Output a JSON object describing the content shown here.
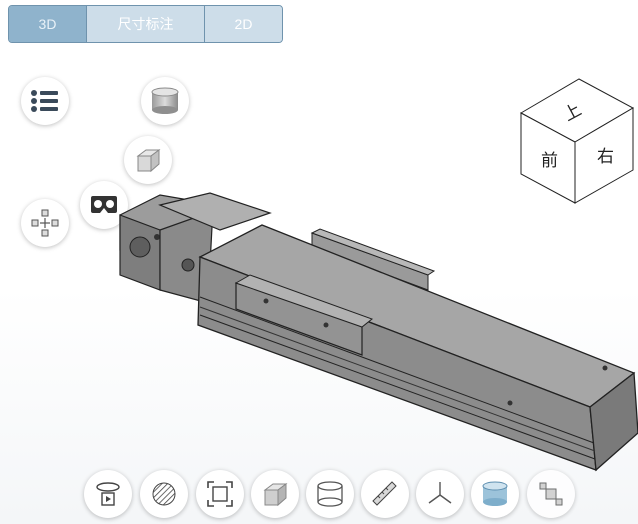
{
  "tabs": [
    {
      "label": "3D",
      "active": true
    },
    {
      "label": "尺寸标注",
      "active": false
    },
    {
      "label": "2D",
      "active": false
    }
  ],
  "viewcube": {
    "top": "上",
    "front": "前",
    "right": "右"
  },
  "side_tools": [
    {
      "icon": "list-icon"
    },
    {
      "icon": "cylinder-shaded-icon"
    },
    {
      "icon": "cube-wireframe-icon"
    },
    {
      "icon": "vr-goggles-icon"
    },
    {
      "icon": "explode-view-icon"
    }
  ],
  "bottom_tools": [
    {
      "icon": "rotate-play-icon"
    },
    {
      "icon": "section-hatch-icon"
    },
    {
      "icon": "fit-view-icon"
    },
    {
      "icon": "cube-shaded-icon"
    },
    {
      "icon": "cylinder-outline-icon"
    },
    {
      "icon": "measure-icon"
    },
    {
      "icon": "axis-icon"
    },
    {
      "icon": "cylinder-blue-icon"
    },
    {
      "icon": "explode-icon"
    }
  ],
  "colors": {
    "tab_active": "#8fb3cc",
    "tab_inactive": "#cddde9",
    "tab_border": "#6f93ad",
    "model_gray": "#8e8e8e"
  }
}
